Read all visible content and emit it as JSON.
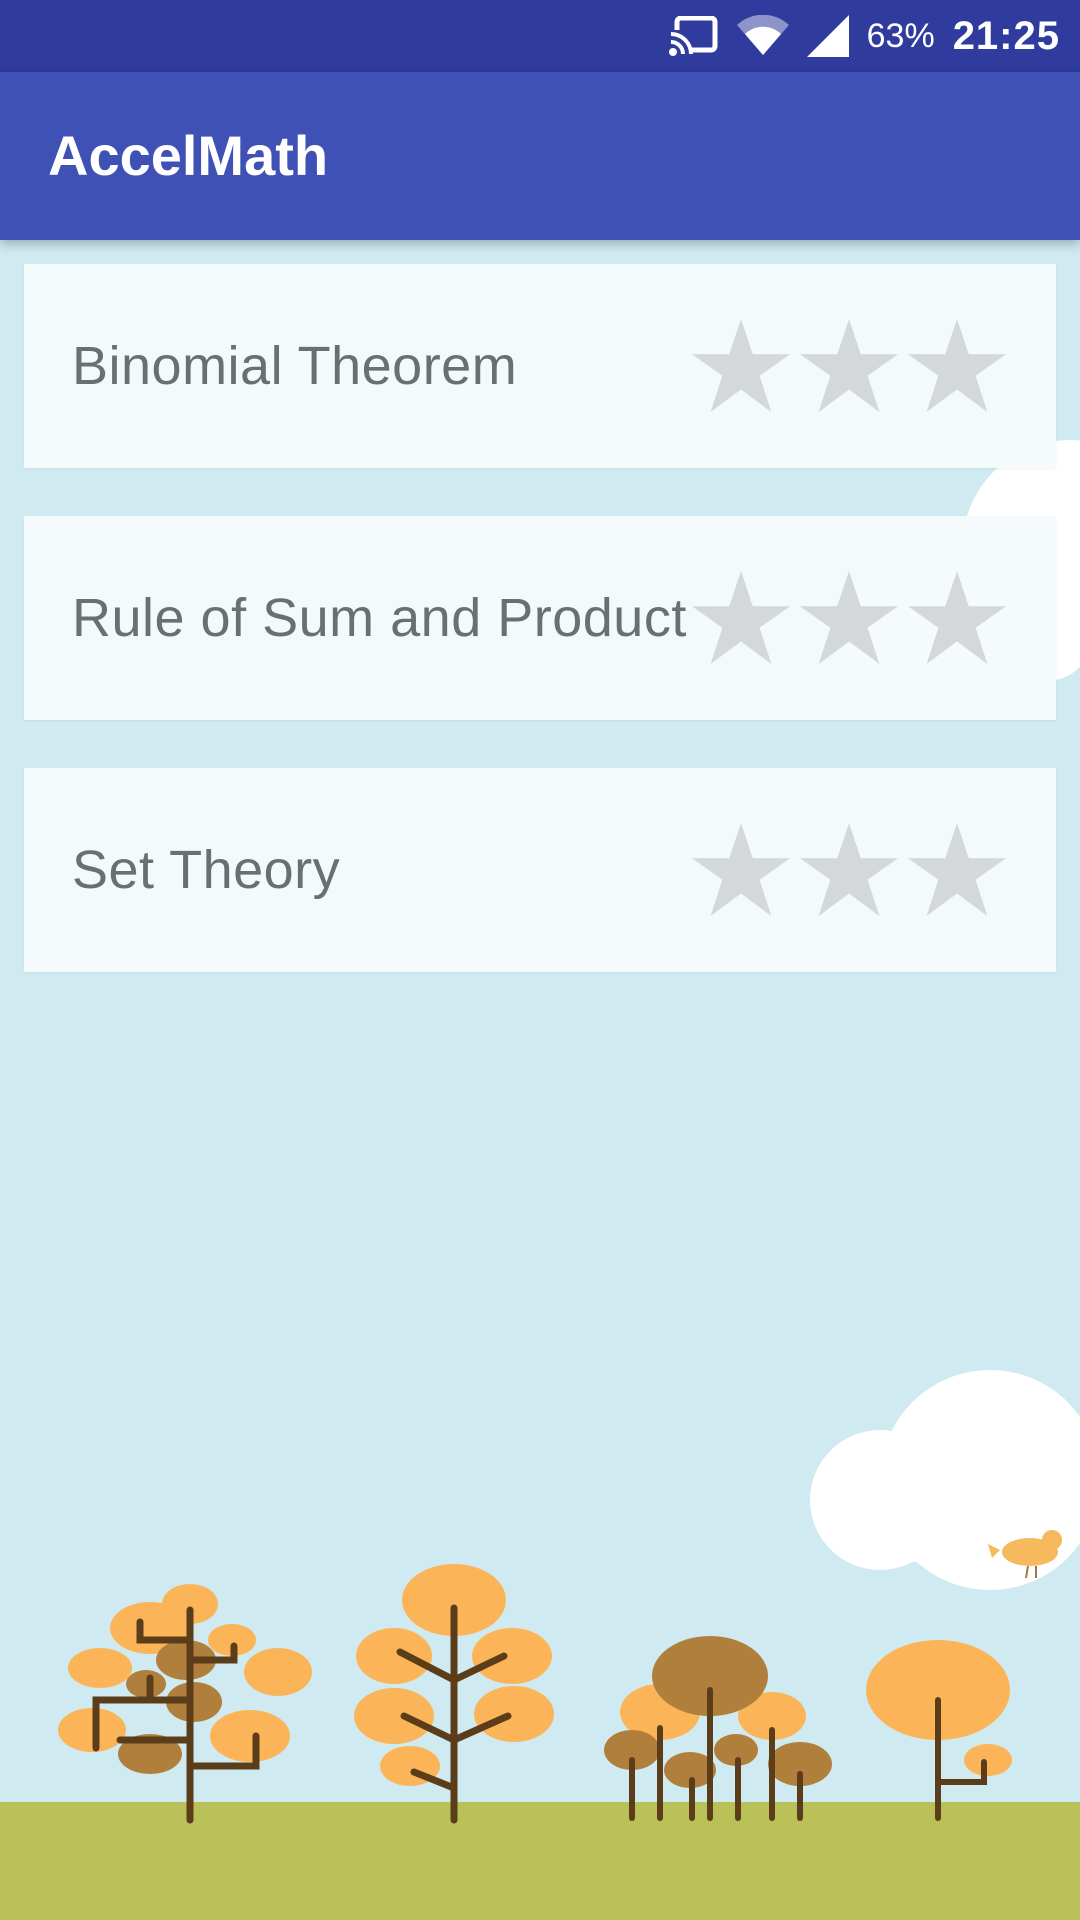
{
  "status_bar": {
    "battery": "63%",
    "time": "21:25",
    "icons": [
      "cast-icon",
      "wifi-icon",
      "signal-icon"
    ]
  },
  "app_bar": {
    "title": "AccelMath"
  },
  "topics": [
    {
      "title": "Binomial Theorem",
      "stars_earned": 0,
      "stars_total": 3
    },
    {
      "title": "Rule of Sum and Product",
      "stars_earned": 0,
      "stars_total": 3
    },
    {
      "title": "Set Theory",
      "stars_earned": 0,
      "stars_total": 3
    }
  ],
  "colors": {
    "status_bar": "#2f3c9e",
    "app_bar": "#3f51b5",
    "background": "#cfeaf0",
    "card": "#f4fbfc",
    "star_empty": "#d5d8d9",
    "ground": "#b9c058",
    "tree_orange": "#fbb558",
    "tree_brown": "#b07f3c"
  }
}
